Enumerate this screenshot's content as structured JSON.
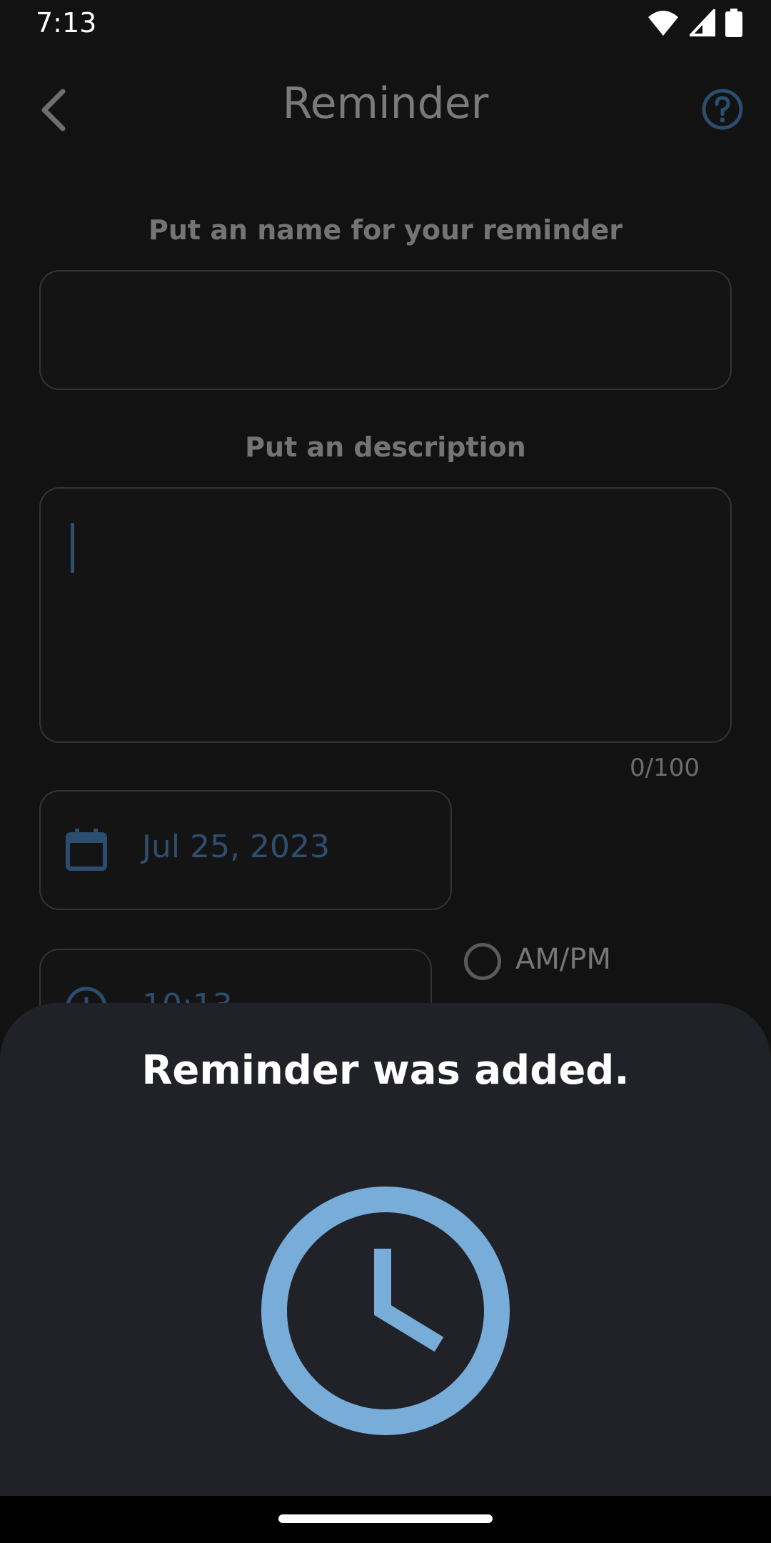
{
  "status_bar": {
    "time": "7:13"
  },
  "header": {
    "title": "Reminder"
  },
  "form": {
    "name_label": "Put an name for your reminder",
    "description_label": "Put an description",
    "description_counter": "0/100",
    "date_value": "Jul 25, 2023",
    "time_value": "10:13",
    "ampm_label": "AM/PM"
  },
  "sheet": {
    "message": "Reminder was added."
  },
  "colors": {
    "accent": "#78acd9",
    "background": "#121213",
    "sheet": "#212227"
  }
}
